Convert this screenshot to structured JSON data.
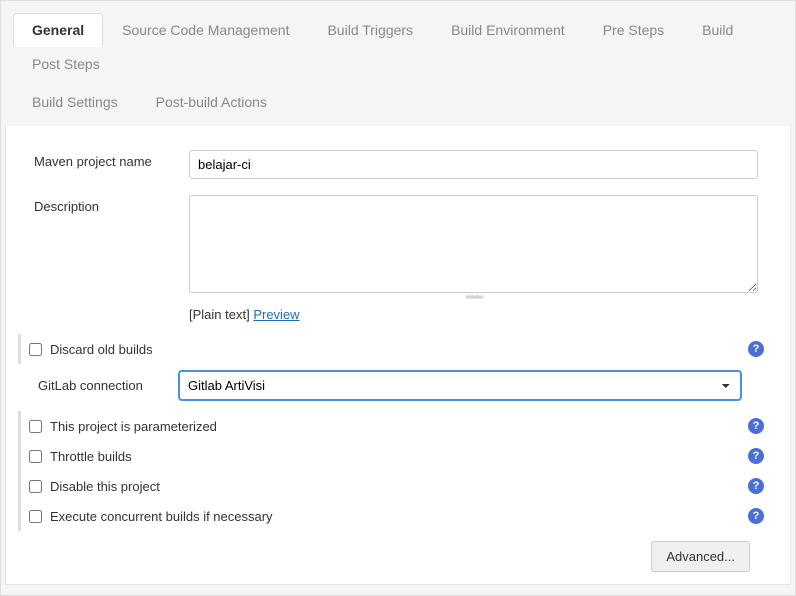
{
  "tabs": {
    "general": "General",
    "scm": "Source Code Management",
    "triggers": "Build Triggers",
    "env": "Build Environment",
    "presteps": "Pre Steps",
    "build": "Build",
    "poststeps": "Post Steps",
    "settings": "Build Settings",
    "postactions": "Post-build Actions"
  },
  "labels": {
    "project_name": "Maven project name",
    "description": "Description",
    "plaintext": "[Plain text]",
    "preview": "Preview",
    "gitlab_conn": "GitLab connection"
  },
  "values": {
    "project_name": "belajar-ci",
    "description": "",
    "gitlab_conn": "Gitlab ArtiVisi"
  },
  "options": {
    "discard": "Discard old builds",
    "parameterized": "This project is parameterized",
    "throttle": "Throttle builds",
    "disable": "Disable this project",
    "concurrent": "Execute concurrent builds if necessary"
  },
  "buttons": {
    "advanced": "Advanced..."
  }
}
